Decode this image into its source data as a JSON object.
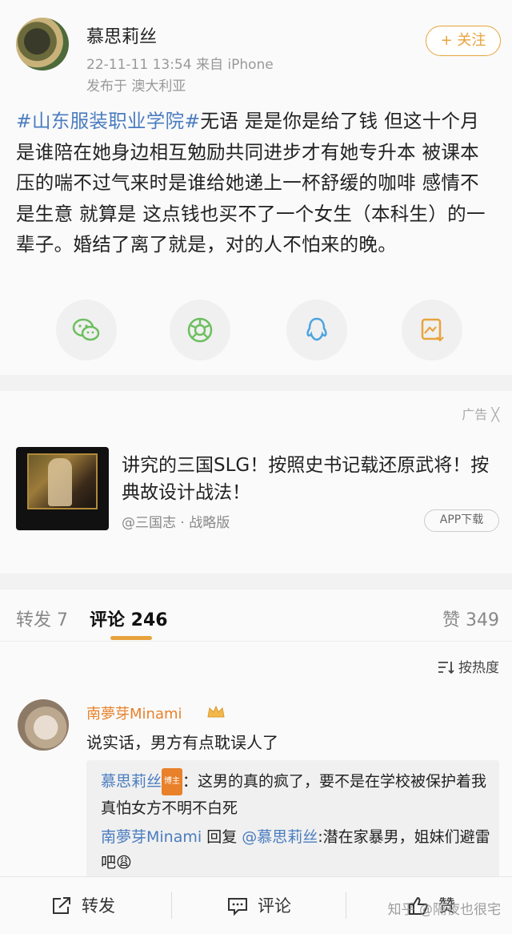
{
  "post": {
    "author": "慕思莉丝",
    "meta": "22-11-11 13:54  来自 iPhone",
    "location": "发布于 澳大利亚",
    "follow_label": "+ 关注",
    "hashtag": "#山东服装职业学院#",
    "body": "无语 是是你是给了钱 但这十个月是谁陪在她身边相互勉励共同进步才有她专升本 被课本压的喘不过气来时是谁给她递上一杯舒缓的咖啡 感情不是生意 就算是 这点钱也买不了一个女生（本科生）的一辈子。婚结了离了就是，对的人不怕来的晚。",
    "share_icons": [
      "wechat-icon",
      "moments-icon",
      "qq-icon",
      "save-image-icon"
    ]
  },
  "ad": {
    "tag": "广告 ╳",
    "title": "讲究的三国SLG！按照史书记载还原武将！按典故设计战法！",
    "source": "@三国志 · 战略版",
    "button": "APP下载"
  },
  "tabs": {
    "repost": "转发 7",
    "comment": "评论 246",
    "likes": "赞 349"
  },
  "comments": {
    "sort_label": "按热度",
    "items": [
      {
        "name": "南夢芽Minami",
        "text": "说实话，男方有点耽误人了",
        "replies": [
          {
            "name": "慕思莉丝",
            "badge": "博主",
            "text": "：这男的真的疯了，要不是在学校被保护着我真怕女方不明不白死"
          },
          {
            "name": "南夢芽Minami",
            "middle": " 回复 ",
            "target": "@慕思莉丝",
            "text": ":潜在家暴男，姐妹们避雷吧😩"
          }
        ]
      }
    ]
  },
  "bottom_bar": {
    "repost": "转发",
    "comment": "评论",
    "like": "赞",
    "watermark": "知乎 @隔夜也很宅"
  },
  "colors": {
    "accent": "#e8a33d",
    "link": "#4a7cc0",
    "username": "#e8812a"
  }
}
